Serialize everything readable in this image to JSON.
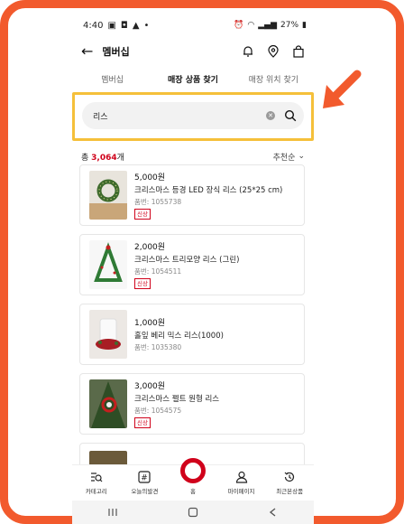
{
  "status_bar": {
    "time": "4:40",
    "left_icons": [
      "gallery-icon",
      "message-icon",
      "alert-icon"
    ],
    "battery": "27%"
  },
  "header": {
    "title": "멤버십",
    "icons": [
      "bell-icon",
      "location-pin-icon",
      "shopping-bag-icon"
    ]
  },
  "tabs": [
    {
      "label": "멤버십",
      "active": false
    },
    {
      "label": "매장 상품 찾기",
      "active": true
    },
    {
      "label": "매장 위치 찾기",
      "active": false
    }
  ],
  "search": {
    "value": "리스",
    "placeholder": ""
  },
  "results": {
    "prefix": "총 ",
    "count": "3,064",
    "suffix": "개",
    "sort_label": "추천순"
  },
  "products": [
    {
      "price": "5,000원",
      "name": "크리스마스 등경 LED 장식 리스 (25*25 cm)",
      "code": "품번: 1055738",
      "badge": "신상"
    },
    {
      "price": "2,000원",
      "name": "크리스마스 트리모양 리스 (그린)",
      "code": "품번: 1054511",
      "badge": "신상"
    },
    {
      "price": "1,000원",
      "name": "홀잎 베리 믹스 리스(1000)",
      "code": "품번: 1035380",
      "badge": ""
    },
    {
      "price": "3,000원",
      "name": "크리스마스 펠트 원형 리스",
      "code": "품번: 1054575",
      "badge": "신상"
    }
  ],
  "bottom_nav": [
    {
      "label": "카테고리",
      "icon": "category-search-icon"
    },
    {
      "label": "오늘의발견",
      "icon": "hashtag-icon"
    },
    {
      "label": "홈",
      "icon": "home-ring-icon"
    },
    {
      "label": "마이페이지",
      "icon": "person-icon"
    },
    {
      "label": "최근본상품",
      "icon": "history-icon"
    }
  ],
  "colors": {
    "accent": "#d0021b",
    "frame": "#f25a2d",
    "highlight": "#f5c03a"
  }
}
